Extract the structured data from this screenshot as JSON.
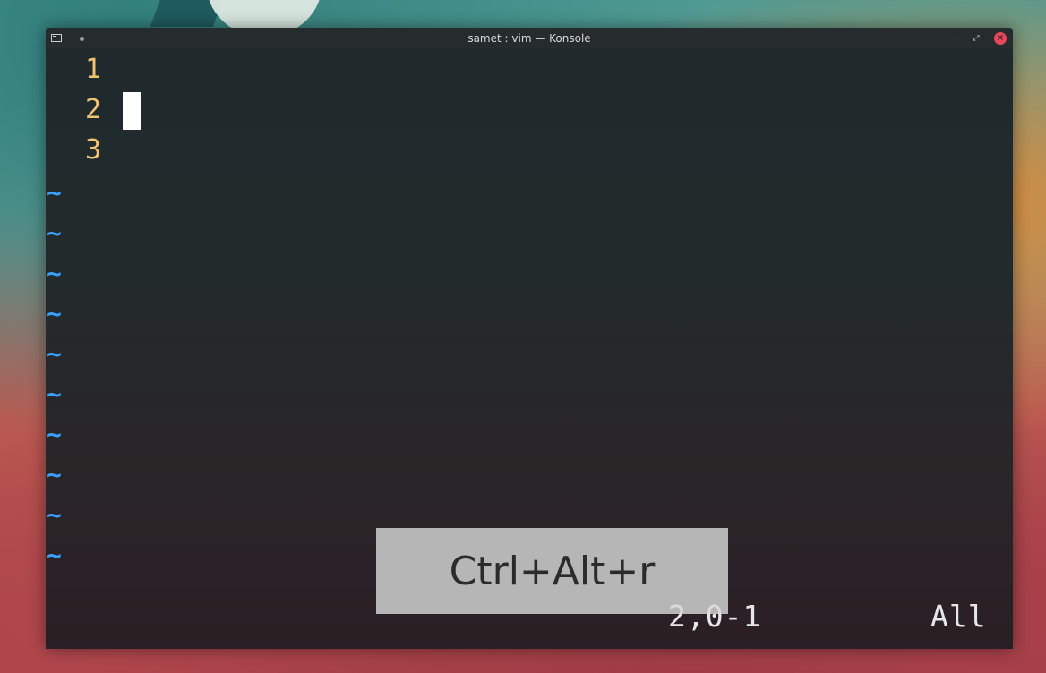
{
  "window": {
    "title": "samet : vim — Konsole",
    "minimize_glyph": "‒",
    "maximize_glyph": "⤢",
    "close_glyph": "×"
  },
  "vim": {
    "lines": [
      {
        "number": "1",
        "text": ""
      },
      {
        "number": "2",
        "text": ""
      },
      {
        "number": "3",
        "text": ""
      }
    ],
    "tilde": "~",
    "status_position": "2,0-1",
    "status_scroll": "All"
  },
  "overlay": {
    "keys": "Ctrl+Alt+r"
  },
  "colors": {
    "line_number": "#f0c475",
    "tilde": "#3aa0ff",
    "close_button": "#e8475d"
  }
}
